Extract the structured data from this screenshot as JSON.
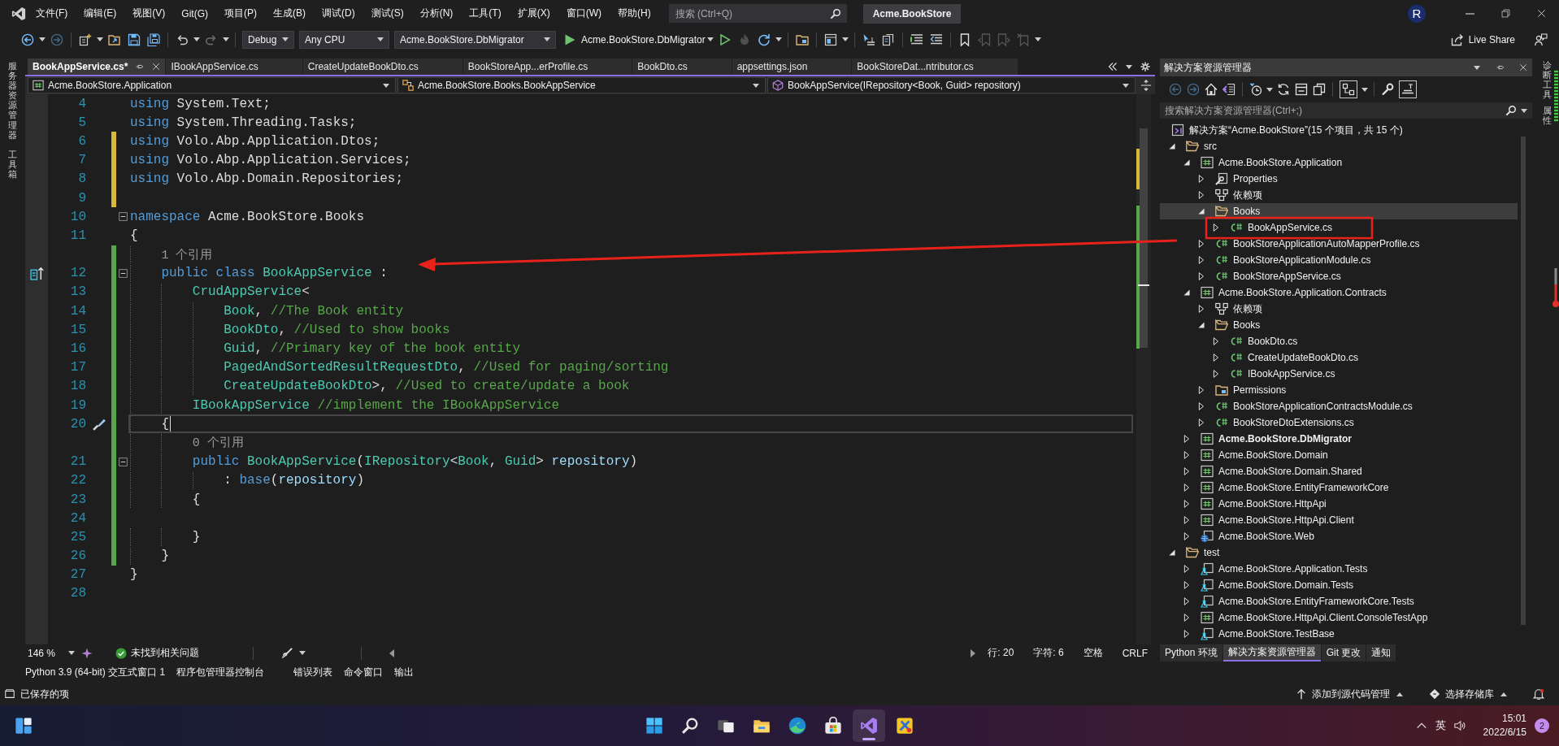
{
  "title_bar": {
    "menu": [
      "文件(F)",
      "编辑(E)",
      "视图(V)",
      "Git(G)",
      "项目(P)",
      "生成(B)",
      "调试(D)",
      "测试(S)",
      "分析(N)",
      "工具(T)",
      "扩展(X)",
      "窗口(W)",
      "帮助(H)"
    ],
    "search": {
      "placeholder": "搜索 (Ctrl+Q)"
    },
    "solution_name": "Acme.BookStore",
    "avatar": "R"
  },
  "toolbar": {
    "items": [
      {
        "kind": "back",
        "disabled": false,
        "menu": true
      },
      {
        "kind": "forward",
        "disabled": true
      },
      {
        "kind": "separator"
      },
      {
        "kind": "new",
        "disabled": false,
        "menu": true
      },
      {
        "kind": "open",
        "disabled": false
      },
      {
        "kind": "save",
        "disabled": false
      },
      {
        "kind": "saveall",
        "disabled": false
      },
      {
        "kind": "separator"
      },
      {
        "kind": "undo",
        "disabled": false,
        "menu": true
      },
      {
        "kind": "redo",
        "disabled": true,
        "menu": true
      },
      {
        "kind": "separator"
      },
      {
        "kind": "combo",
        "value": "Debug"
      },
      {
        "kind": "combo",
        "value": "Any CPU"
      },
      {
        "kind": "combo",
        "value": "Acme.BookStore.DbMigrator"
      },
      {
        "kind": "run",
        "label": "Acme.BookStore.DbMigrator",
        "disabled": false,
        "menu": true
      },
      {
        "kind": "start",
        "disabled": false
      },
      {
        "kind": "hotreload",
        "disabled": true
      },
      {
        "kind": "restart",
        "disabled": false,
        "menu": true
      },
      {
        "kind": "separator"
      },
      {
        "kind": "folder",
        "disabled": false
      },
      {
        "kind": "separator"
      },
      {
        "kind": "layout",
        "disabled": false,
        "menu": true
      },
      {
        "kind": "separator"
      },
      {
        "kind": "pointer",
        "disabled": false
      },
      {
        "kind": "copy",
        "disabled": false
      },
      {
        "kind": "separator"
      },
      {
        "kind": "comment",
        "disabled": false
      },
      {
        "kind": "uncomment",
        "disabled": false
      },
      {
        "kind": "separator"
      },
      {
        "kind": "bookmark",
        "disabled": false
      },
      {
        "kind": "bookmarkprev",
        "disabled": true
      },
      {
        "kind": "bookmarknext",
        "disabled": true
      },
      {
        "kind": "bookmarkclear",
        "disabled": true,
        "menu": true
      }
    ],
    "live_share": "Live Share"
  },
  "left_strip": [
    "服务器资源管理器",
    "工具箱"
  ],
  "editor": {
    "tabs": [
      {
        "label": "BookAppService.cs*",
        "selected": true
      },
      {
        "label": "IBookAppService.cs",
        "selected": false
      },
      {
        "label": "CreateUpdateBookDto.cs",
        "selected": false
      },
      {
        "label": "BookStoreApp...erProfile.cs",
        "selected": false
      },
      {
        "label": "BookDto.cs",
        "selected": false
      },
      {
        "label": "appsettings.json",
        "selected": false
      },
      {
        "label": "BookStoreDat...ntributor.cs",
        "selected": false
      }
    ],
    "navigation": [
      {
        "kind": "project",
        "label": "Acme.BookStore.Application"
      },
      {
        "kind": "class",
        "label": "Acme.BookStore.Books.BookAppService"
      },
      {
        "kind": "method",
        "label": "BookAppService(IRepository<Book, Guid> repository)"
      }
    ],
    "lines": [
      {
        "kind": "code",
        "number": "4",
        "tokens": [
          {
            "kind": "keyword",
            "text": "using"
          },
          {
            "kind": "plain",
            "text": " System.Text;"
          }
        ]
      },
      {
        "kind": "code",
        "number": "5",
        "tokens": [
          {
            "kind": "keyword",
            "text": "using"
          },
          {
            "kind": "plain",
            "text": " System.Threading.Tasks;"
          }
        ]
      },
      {
        "kind": "code",
        "number": "6",
        "unsaved_change": true,
        "tokens": [
          {
            "kind": "keyword",
            "text": "using"
          },
          {
            "kind": "plain",
            "text": " Volo.Abp.Application.Dtos;"
          }
        ]
      },
      {
        "kind": "code",
        "number": "7",
        "unsaved_change": true,
        "tokens": [
          {
            "kind": "keyword",
            "text": "using"
          },
          {
            "kind": "plain",
            "text": " Volo.Abp.Application.Services;"
          }
        ]
      },
      {
        "kind": "code",
        "number": "8",
        "unsaved_change": true,
        "tokens": [
          {
            "kind": "keyword",
            "text": "using"
          },
          {
            "kind": "plain",
            "text": " Volo.Abp.Domain.Repositories;"
          }
        ]
      },
      {
        "kind": "code",
        "number": "9",
        "unsaved_change": true
      },
      {
        "kind": "code",
        "number": "10",
        "fold_expanded": true,
        "tokens": [
          {
            "kind": "keyword",
            "text": "namespace"
          },
          {
            "kind": "plain",
            "text": " Acme.BookStore.Books"
          }
        ]
      },
      {
        "kind": "code",
        "number": "11",
        "tokens": [
          {
            "kind": "plain",
            "text": "{"
          }
        ]
      },
      {
        "kind": "codelens",
        "saved_change": true,
        "text": "    1 个引用"
      },
      {
        "kind": "code",
        "number": "12",
        "saved_change": true,
        "fold_expanded": true,
        "margin_icon": {
          "kind": "inheritance"
        },
        "tokens": [
          {
            "kind": "keyword",
            "text": "    public class"
          },
          {
            "kind": "type",
            "text": " BookAppService"
          },
          {
            "kind": "plain",
            "text": " :"
          }
        ]
      },
      {
        "kind": "code",
        "number": "13",
        "saved_change": true,
        "tokens": [
          {
            "kind": "type",
            "text": "        CrudAppService"
          },
          {
            "kind": "plain",
            "text": "<"
          }
        ]
      },
      {
        "kind": "code",
        "number": "14",
        "saved_change": true,
        "tokens": [
          {
            "kind": "type",
            "text": "            Book"
          },
          {
            "kind": "plain",
            "text": ", "
          },
          {
            "kind": "comment",
            "text": "//The Book entity"
          }
        ]
      },
      {
        "kind": "code",
        "number": "15",
        "saved_change": true,
        "tokens": [
          {
            "kind": "type",
            "text": "            BookDto"
          },
          {
            "kind": "plain",
            "text": ", "
          },
          {
            "kind": "comment",
            "text": "//Used to show books"
          }
        ]
      },
      {
        "kind": "code",
        "number": "16",
        "saved_change": true,
        "tokens": [
          {
            "kind": "type",
            "text": "            Guid"
          },
          {
            "kind": "plain",
            "text": ", "
          },
          {
            "kind": "comment",
            "text": "//Primary key of the book entity"
          }
        ]
      },
      {
        "kind": "code",
        "number": "17",
        "saved_change": true,
        "tokens": [
          {
            "kind": "type",
            "text": "            PagedAndSortedResultRequestDto"
          },
          {
            "kind": "plain",
            "text": ", "
          },
          {
            "kind": "comment",
            "text": "//Used for paging/sorting"
          }
        ]
      },
      {
        "kind": "code",
        "number": "18",
        "saved_change": true,
        "tokens": [
          {
            "kind": "type",
            "text": "            CreateUpdateBookDto"
          },
          {
            "kind": "plain",
            "text": ">, "
          },
          {
            "kind": "comment",
            "text": "//Used to create/update a book"
          }
        ]
      },
      {
        "kind": "code",
        "number": "19",
        "saved_change": true,
        "tokens": [
          {
            "kind": "type",
            "text": "        IBookAppService"
          },
          {
            "kind": "comment",
            "text": " //implement the IBookAppService"
          }
        ]
      },
      {
        "kind": "code",
        "number": "20",
        "saved_change": true,
        "current": true,
        "margin_icon": {
          "kind": "quickaction"
        },
        "tokens": [
          {
            "kind": "plain",
            "text": "    {"
          }
        ]
      },
      {
        "kind": "codelens",
        "saved_change": true,
        "text": "        0 个引用"
      },
      {
        "kind": "code",
        "number": "21",
        "saved_change": true,
        "fold_expanded": true,
        "tokens": [
          {
            "kind": "keyword",
            "text": "        public"
          },
          {
            "kind": "type",
            "text": " BookAppService"
          },
          {
            "kind": "plain",
            "text": "("
          },
          {
            "kind": "type",
            "text": "IRepository"
          },
          {
            "kind": "plain",
            "text": "<"
          },
          {
            "kind": "type",
            "text": "Book"
          },
          {
            "kind": "plain",
            "text": ", "
          },
          {
            "kind": "type",
            "text": "Guid"
          },
          {
            "kind": "plain",
            "text": "> "
          },
          {
            "kind": "parameter",
            "text": "repository"
          },
          {
            "kind": "plain",
            "text": ")"
          }
        ]
      },
      {
        "kind": "code",
        "number": "22",
        "saved_change": true,
        "tokens": [
          {
            "kind": "plain",
            "text": "            : "
          },
          {
            "kind": "keyword",
            "text": "base"
          },
          {
            "kind": "plain",
            "text": "("
          },
          {
            "kind": "parameter",
            "text": "repository"
          },
          {
            "kind": "plain",
            "text": ")"
          }
        ]
      },
      {
        "kind": "code",
        "number": "23",
        "saved_change": true,
        "tokens": [
          {
            "kind": "plain",
            "text": "        {"
          }
        ]
      },
      {
        "kind": "code",
        "number": "24",
        "saved_change": true
      },
      {
        "kind": "code",
        "number": "25",
        "saved_change": true,
        "tokens": [
          {
            "kind": "plain",
            "text": "        }"
          }
        ]
      },
      {
        "kind": "code",
        "number": "26",
        "saved_change": true,
        "tokens": [
          {
            "kind": "plain",
            "text": "    }"
          }
        ]
      },
      {
        "kind": "code",
        "number": "27",
        "tokens": [
          {
            "kind": "plain",
            "text": "}"
          }
        ]
      },
      {
        "kind": "code",
        "number": "28"
      }
    ],
    "status": {
      "zoom": "146 %",
      "issues": "未找到相关问题",
      "line": "行: 20",
      "column": "字符: 6",
      "indentation": "空格",
      "line_ending": "CRLF"
    }
  },
  "solution_explorer": {
    "title": "解决方案资源管理器",
    "toolbar": [
      {
        "kind": "back",
        "disabled": true,
        "on": false
      },
      {
        "kind": "forward",
        "disabled": true,
        "on": false
      },
      {
        "kind": "home",
        "disabled": false,
        "on": false
      },
      {
        "kind": "switchviews",
        "disabled": false,
        "on": false
      },
      {
        "kind": "separator"
      },
      {
        "kind": "pending",
        "disabled": false,
        "on": false,
        "menu": true
      },
      {
        "kind": "sync",
        "disabled": false,
        "on": false
      },
      {
        "kind": "collapse",
        "disabled": false,
        "on": false
      },
      {
        "kind": "showall",
        "disabled": false,
        "on": false
      },
      {
        "kind": "separator"
      },
      {
        "kind": "filter",
        "disabled": false,
        "on": true,
        "menu": true
      },
      {
        "kind": "separator"
      },
      {
        "kind": "properties",
        "disabled": false,
        "on": false
      },
      {
        "kind": "preview",
        "disabled": false,
        "on": true
      }
    ],
    "search": {
      "placeholder": "搜索解决方案资源管理器(Ctrl+;)"
    },
    "solution": {
      "label": "解决方案“Acme.BookStore”(15 个项目，共 15 个)",
      "kind": "solution",
      "selected": false,
      "children": [
        {
          "label": "src",
          "kind": "solutionfolder",
          "expanded": true,
          "selected": false,
          "children": [
            {
              "label": "Acme.BookStore.Application",
              "kind": "project",
              "expanded": true,
              "selected": false,
              "startup": false,
              "children": [
                {
                  "label": "Properties",
                  "kind": "properties",
                  "expanded": false,
                  "selected": false
                },
                {
                  "label": "依赖项",
                  "kind": "references",
                  "expanded": false,
                  "selected": false
                },
                {
                  "label": "Books",
                  "kind": "folder",
                  "expanded": true,
                  "selected": true,
                  "children": [
                    {
                      "label": "BookAppService.cs",
                      "kind": "csharp",
                      "expanded": false,
                      "selected": false
                    }
                  ]
                },
                {
                  "label": "BookStoreApplicationAutoMapperProfile.cs",
                  "kind": "csharp",
                  "expanded": false,
                  "selected": false
                },
                {
                  "label": "BookStoreApplicationModule.cs",
                  "kind": "csharp",
                  "expanded": false,
                  "selected": false
                },
                {
                  "label": "BookStoreAppService.cs",
                  "kind": "csharp",
                  "expanded": false,
                  "selected": false
                }
              ]
            },
            {
              "label": "Acme.BookStore.Application.Contracts",
              "kind": "project",
              "expanded": true,
              "selected": false,
              "startup": false,
              "children": [
                {
                  "label": "依赖项",
                  "kind": "references",
                  "expanded": false,
                  "selected": false
                },
                {
                  "label": "Books",
                  "kind": "folder",
                  "expanded": true,
                  "selected": false,
                  "children": [
                    {
                      "label": "BookDto.cs",
                      "kind": "csharp",
                      "expanded": false,
                      "selected": false
                    },
                    {
                      "label": "CreateUpdateBookDto.cs",
                      "kind": "csharp",
                      "expanded": false,
                      "selected": false
                    },
                    {
                      "label": "IBookAppService.cs",
                      "kind": "csharp",
                      "expanded": false,
                      "selected": false
                    }
                  ]
                },
                {
                  "label": "Permissions",
                  "kind": "folder",
                  "expanded": false,
                  "selected": false
                },
                {
                  "label": "BookStoreApplicationContractsModule.cs",
                  "kind": "csharp",
                  "expanded": false,
                  "selected": false
                },
                {
                  "label": "BookStoreDtoExtensions.cs",
                  "kind": "csharp",
                  "expanded": false,
                  "selected": false
                }
              ]
            },
            {
              "label": "Acme.BookStore.DbMigrator",
              "kind": "project",
              "expanded": false,
              "selected": false,
              "startup": true
            },
            {
              "label": "Acme.BookStore.Domain",
              "kind": "project",
              "expanded": false,
              "selected": false,
              "startup": false
            },
            {
              "label": "Acme.BookStore.Domain.Shared",
              "kind": "project",
              "expanded": false,
              "selected": false,
              "startup": false
            },
            {
              "label": "Acme.BookStore.EntityFrameworkCore",
              "kind": "project",
              "expanded": false,
              "selected": false,
              "startup": false
            },
            {
              "label": "Acme.BookStore.HttpApi",
              "kind": "project",
              "expanded": false,
              "selected": false,
              "startup": false
            },
            {
              "label": "Acme.BookStore.HttpApi.Client",
              "kind": "project",
              "expanded": false,
              "selected": false,
              "startup": false
            },
            {
              "label": "Acme.BookStore.Web",
              "kind": "web",
              "expanded": false,
              "selected": false,
              "startup": false
            }
          ]
        },
        {
          "label": "test",
          "kind": "solutionfolder",
          "expanded": true,
          "selected": false,
          "children": [
            {
              "label": "Acme.BookStore.Application.Tests",
              "kind": "test",
              "expanded": false,
              "selected": false,
              "startup": false
            },
            {
              "label": "Acme.BookStore.Domain.Tests",
              "kind": "test",
              "expanded": false,
              "selected": false,
              "startup": false
            },
            {
              "label": "Acme.BookStore.EntityFrameworkCore.Tests",
              "kind": "test",
              "expanded": false,
              "selected": false,
              "startup": false
            },
            {
              "label": "Acme.BookStore.HttpApi.Client.ConsoleTestApp",
              "kind": "project",
              "expanded": false,
              "selected": false,
              "startup": false
            },
            {
              "label": "Acme.BookStore.TestBase",
              "kind": "test",
              "expanded": false,
              "selected": false,
              "startup": false
            }
          ]
        }
      ]
    },
    "tabs": [
      {
        "label": "Python 环境",
        "selected": false
      },
      {
        "label": "解决方案资源管理器",
        "selected": true
      },
      {
        "label": "Git 更改",
        "selected": false
      },
      {
        "label": "通知",
        "selected": false
      }
    ]
  },
  "right_strip": [
    "诊断工具",
    "属性"
  ],
  "tool_windows": [
    [
      "Python 3.9 (64-bit) 交互式窗口 1",
      "程序包管理器控制台"
    ],
    [
      "错误列表",
      "命令窗口",
      "输出"
    ]
  ],
  "status_bar": {
    "message": "已保存的项",
    "source_control": "添加到源代码管理",
    "repository": "选择存储库"
  },
  "taskbar": {
    "apps": [
      {
        "kind": "start",
        "active": false
      },
      {
        "kind": "search",
        "active": false
      },
      {
        "kind": "taskview",
        "active": false
      },
      {
        "kind": "explorer",
        "active": false
      },
      {
        "kind": "edge",
        "active": false
      },
      {
        "kind": "store",
        "active": false
      },
      {
        "kind": "vs",
        "active": true
      },
      {
        "kind": "tool",
        "active": false
      }
    ],
    "input_method": "英",
    "time": "15:01",
    "date": "2022/6/15",
    "notifications": "2"
  }
}
